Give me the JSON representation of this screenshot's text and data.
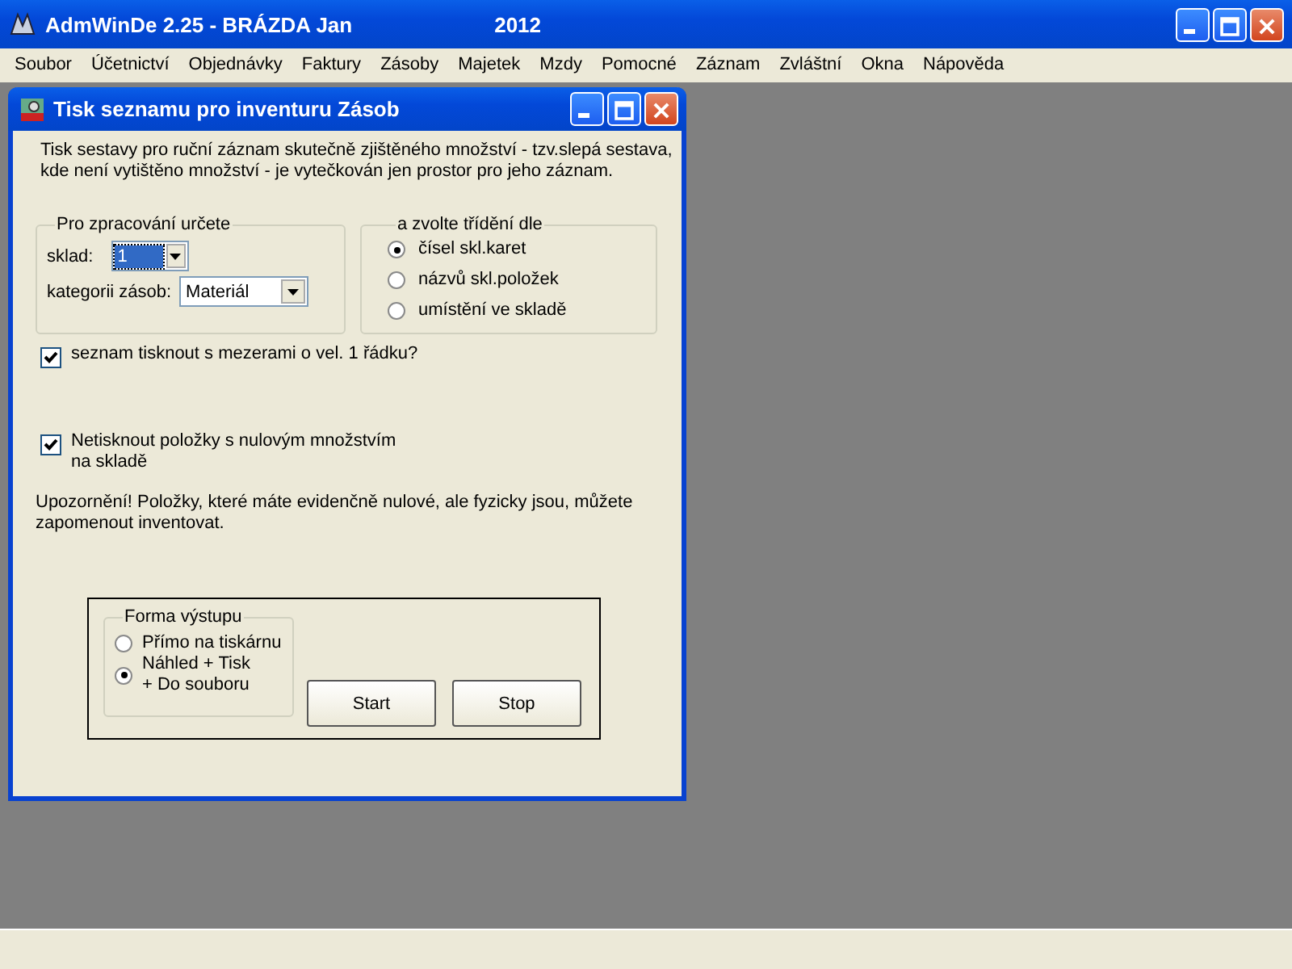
{
  "window": {
    "title": "AdmWinDe 2.25 - BRÁZDA Jan",
    "year": "2012"
  },
  "menu": [
    "Soubor",
    "Účetnictví",
    "Objednávky",
    "Faktury",
    "Zásoby",
    "Majetek",
    "Mzdy",
    "Pomocné",
    "Záznam",
    "Zvláštní",
    "Okna",
    "Nápověda"
  ],
  "dialog": {
    "title": "Tisk seznamu pro inventuru Zásob",
    "intro": "Tisk sestavy pro ruční záznam skutečně zjištěného množství - tzv.slepá sestava,\nkde není vytištěno množství - je vytečkován jen prostor pro jeho záznam.",
    "processing": {
      "legend": "Pro zpracování určete",
      "fields": [
        {
          "label": "sklad:",
          "value": "1",
          "focused": true
        },
        {
          "label": "kategorii zásob:",
          "value": "Materiál",
          "focused": false
        }
      ]
    },
    "sorting": {
      "legend": "a zvolte třídění dle",
      "options": [
        {
          "label": "čísel skl.karet",
          "selected": true
        },
        {
          "label": "názvů skl.položek",
          "selected": false
        },
        {
          "label": "umístění ve skladě",
          "selected": false
        }
      ]
    },
    "checkboxes": [
      {
        "label": "seznam tisknout s mezerami o vel. 1 řádku?",
        "checked": true
      },
      {
        "label": "Netisknout položky s nulovým množstvím\nna skladě",
        "checked": true
      }
    ],
    "warning": "Upozornění!  Položky, které máte evidenčně nulové, ale fyzicky jsou, můžete\nzapomenout inventovat.",
    "output": {
      "legend": "Forma výstupu",
      "options": [
        {
          "label": "Přímo na tiskárnu",
          "selected": false
        },
        {
          "label": "Náhled + Tisk\n+ Do souboru",
          "selected": true
        }
      ]
    },
    "buttons": [
      "Start",
      "Stop"
    ]
  }
}
